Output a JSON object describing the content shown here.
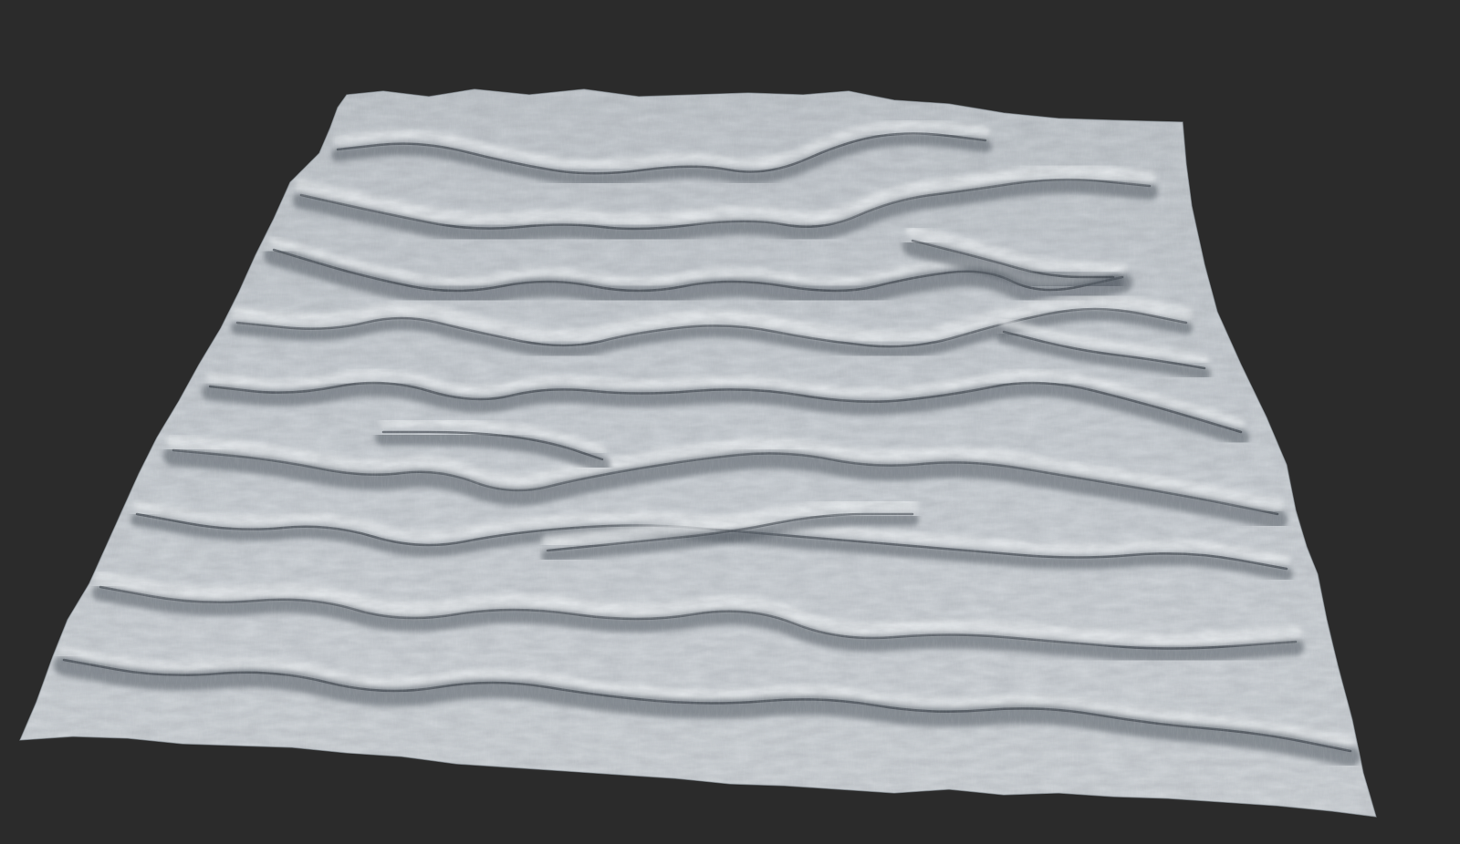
{
  "viewport": {
    "background_color": "#2b2b2b"
  },
  "terrain": {
    "surface_color": "#c5cace",
    "highlight_color": "#eef1f3",
    "shadow_color": "#4b525b",
    "deep_shadow_color": "#2a3038"
  }
}
